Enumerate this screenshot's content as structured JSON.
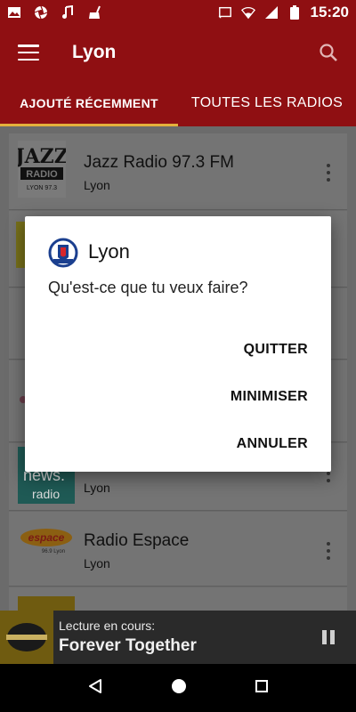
{
  "status_bar": {
    "time": "15:20",
    "left_icons": [
      "image-icon",
      "aperture-icon",
      "music-note-icon",
      "cleaner-icon"
    ],
    "right_icons": [
      "cast-icon",
      "wifi-icon",
      "signal-icon",
      "battery-icon"
    ]
  },
  "app_bar": {
    "title": "Lyon"
  },
  "tabs": [
    {
      "label": "AJOUTÉ RÉCEMMENT",
      "active": true
    },
    {
      "label": "TOUTES LES RADIOS",
      "active": false
    }
  ],
  "stations": [
    {
      "name": "Jazz Radio 97.3 FM",
      "city": "Lyon",
      "logo_text": [
        "JAZZ",
        "RADIO",
        "LYON 97.3"
      ]
    },
    {
      "name": "",
      "city": ""
    },
    {
      "name": "",
      "city": ""
    },
    {
      "name": "",
      "city": ""
    },
    {
      "name": "",
      "city": "Lyon",
      "logo_text": [
        "news.",
        "radio"
      ]
    },
    {
      "name": "Radio Espace",
      "city": "Lyon",
      "logo_text": [
        "espace",
        "96.9 Lyon"
      ]
    }
  ],
  "now_playing": {
    "label": "Lecture en cours:",
    "title": "Forever Together"
  },
  "dialog": {
    "title": "Lyon",
    "message": "Qu'est-ce que tu veux faire?",
    "buttons": {
      "quit": "QUITTER",
      "minimize": "MINIMISER",
      "cancel": "ANNULER"
    }
  },
  "colors": {
    "primary": "#8f0f12",
    "tab_indicator": "#e4b03c",
    "scrim_list": "#6b6b6b"
  }
}
